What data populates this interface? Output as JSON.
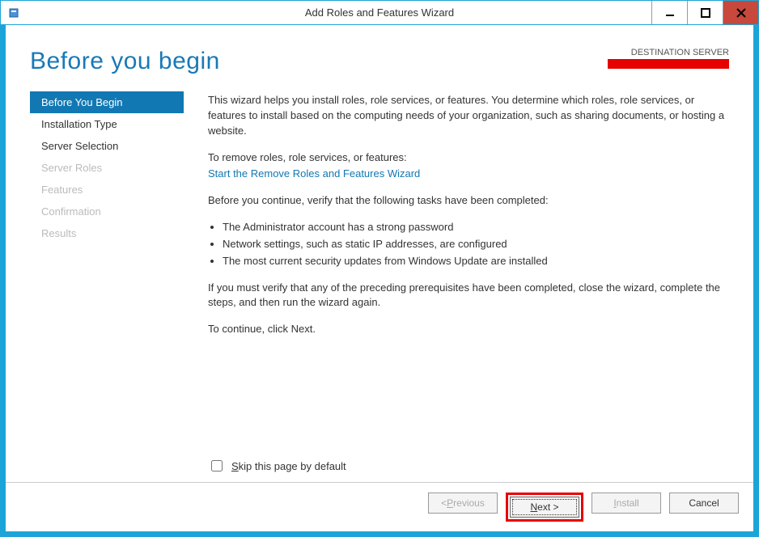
{
  "window": {
    "title": "Add Roles and Features Wizard"
  },
  "header": {
    "heading": "Before you begin",
    "destination_label": "DESTINATION SERVER"
  },
  "sidebar": {
    "items": [
      {
        "label": "Before You Begin",
        "state": "selected"
      },
      {
        "label": "Installation Type",
        "state": "enabled"
      },
      {
        "label": "Server Selection",
        "state": "enabled"
      },
      {
        "label": "Server Roles",
        "state": "disabled"
      },
      {
        "label": "Features",
        "state": "disabled"
      },
      {
        "label": "Confirmation",
        "state": "disabled"
      },
      {
        "label": "Results",
        "state": "disabled"
      }
    ]
  },
  "content": {
    "intro": "This wizard helps you install roles, role services, or features. You determine which roles, role services, or features to install based on the computing needs of your organization, such as sharing documents, or hosting a website.",
    "remove_lead": "To remove roles, role services, or features:",
    "remove_link": "Start the Remove Roles and Features Wizard",
    "verify_lead": "Before you continue, verify that the following tasks have been completed:",
    "bullets": [
      "The Administrator account has a strong password",
      "Network settings, such as static IP addresses, are configured",
      "The most current security updates from Windows Update are installed"
    ],
    "if_you_must": "If you must verify that any of the preceding prerequisites have been completed, close the wizard, complete the steps, and then run the wizard again.",
    "to_continue": "To continue, click Next.",
    "skip_label": "Skip this page by default"
  },
  "footer": {
    "previous": "< Previous",
    "next": "Next >",
    "install": "Install",
    "cancel": "Cancel"
  }
}
